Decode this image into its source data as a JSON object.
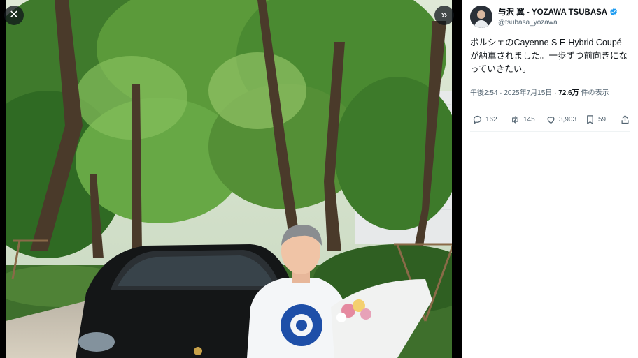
{
  "viewer": {
    "close_icon": "close-icon",
    "next_icon": "chevron-double-right-icon",
    "close_glyph": "✕",
    "next_glyph": "»"
  },
  "tweet": {
    "display_name": "与沢 翼 - YOZAWA TSUBASA",
    "handle": "@tsubasa_yozawa",
    "verified": true,
    "text": "ポルシェのCayenne S E-Hybrid Coupé が納車されました。一歩ずつ前向きになっていきたい。",
    "time": "午後2:54",
    "separator": "·",
    "date": "2025年7月15日",
    "views": "72.6万",
    "views_suffix": "件の表示"
  },
  "actions": {
    "replies": "162",
    "retweets": "145",
    "likes": "3,903",
    "bookmarks": "59"
  },
  "colors": {
    "verified_blue": "#1d9bf0",
    "text_primary": "#0f1419",
    "text_secondary": "#536471"
  }
}
